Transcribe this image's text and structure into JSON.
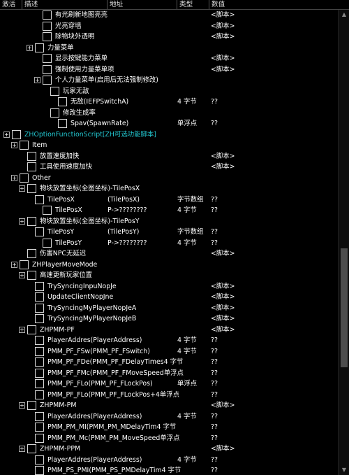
{
  "header": {
    "active": "激活",
    "description": "描述",
    "address": "地址",
    "type": "类型",
    "value": "数值"
  },
  "rows": [
    {
      "level": 4,
      "exp": false,
      "cb": true,
      "desc": "有光刷新地图亮亮",
      "addr": "",
      "type": "",
      "val": "<脚本>",
      "cyan": false
    },
    {
      "level": 4,
      "exp": false,
      "cb": true,
      "desc": "光亮穿墙",
      "addr": "",
      "type": "",
      "val": "<脚本>",
      "cyan": false
    },
    {
      "level": 4,
      "exp": false,
      "cb": true,
      "desc": "除物块外透明",
      "addr": "",
      "type": "",
      "val": "<脚本>",
      "cyan": false
    },
    {
      "level": 3,
      "exp": true,
      "cb": true,
      "desc": "力量菜单",
      "addr": "",
      "type": "",
      "val": "",
      "cyan": false
    },
    {
      "level": 4,
      "exp": false,
      "cb": true,
      "desc": "显示按键能力菜单",
      "addr": "",
      "type": "",
      "val": "<脚本>",
      "cyan": false
    },
    {
      "level": 4,
      "exp": false,
      "cb": true,
      "desc": "强制使用力量菜单项",
      "addr": "",
      "type": "",
      "val": "<脚本>",
      "cyan": false
    },
    {
      "level": 4,
      "exp": true,
      "cb": true,
      "desc": "个人力量菜单(启用后无法强制修改)",
      "addr": "",
      "type": "",
      "val": "",
      "cyan": false
    },
    {
      "level": 5,
      "exp": false,
      "cb": true,
      "desc": "玩家无敌",
      "addr": "",
      "type": "",
      "val": "",
      "cyan": false
    },
    {
      "level": 6,
      "exp": false,
      "cb": true,
      "desc": "无敌(IEFPSwitchA)",
      "addr": "",
      "type": "4 字节",
      "val": "??",
      "cyan": false
    },
    {
      "level": 5,
      "exp": false,
      "cb": true,
      "desc": "修改生成率",
      "addr": "",
      "type": "",
      "val": "",
      "cyan": false
    },
    {
      "level": 6,
      "exp": false,
      "cb": true,
      "desc": "Spav(SpawnRate)",
      "addr": "",
      "type": "单浮点",
      "val": "??",
      "cyan": false
    },
    {
      "level": 0,
      "exp": true,
      "cb": true,
      "desc": "ZHOptionFunctionScript[ZH可选功能脚本]",
      "addr": "",
      "type": "",
      "val": "",
      "cyan": true
    },
    {
      "level": 1,
      "exp": true,
      "cb": true,
      "desc": "Item",
      "addr": "",
      "type": "",
      "val": "",
      "cyan": false
    },
    {
      "level": 2,
      "exp": false,
      "cb": true,
      "desc": "放置速度加快",
      "addr": "",
      "type": "",
      "val": "<脚本>",
      "cyan": false
    },
    {
      "level": 2,
      "exp": false,
      "cb": true,
      "desc": "工具使用速度加快",
      "addr": "",
      "type": "",
      "val": "<脚本>",
      "cyan": false
    },
    {
      "level": 1,
      "exp": true,
      "cb": true,
      "desc": "Other",
      "addr": "",
      "type": "",
      "val": "",
      "cyan": false
    },
    {
      "level": 2,
      "exp": true,
      "cb": true,
      "desc": "物块放置坐标(全图坐标)-TilePosX",
      "addr": "",
      "type": "",
      "val": "",
      "cyan": false
    },
    {
      "level": 3,
      "exp": false,
      "cb": true,
      "desc": "TilePosX",
      "addr": "(TilePosX)",
      "type": "字节数组",
      "val": "??",
      "cyan": false
    },
    {
      "level": 4,
      "exp": false,
      "cb": true,
      "desc": "TilePosX",
      "addr": "P->????????",
      "type": "4 字节",
      "val": "??",
      "cyan": false
    },
    {
      "level": 2,
      "exp": true,
      "cb": true,
      "desc": "物块放置坐标(全图坐标)-TilePosY",
      "addr": "",
      "type": "",
      "val": "",
      "cyan": false
    },
    {
      "level": 3,
      "exp": false,
      "cb": true,
      "desc": "TilePosY",
      "addr": "(TilePosY)",
      "type": "字节数组",
      "val": "??",
      "cyan": false
    },
    {
      "level": 4,
      "exp": false,
      "cb": true,
      "desc": "TilePosY",
      "addr": "P->????????",
      "type": "4 字节",
      "val": "??",
      "cyan": false
    },
    {
      "level": 2,
      "exp": false,
      "cb": true,
      "desc": "伤害NPC无延迟",
      "addr": "",
      "type": "",
      "val": "<脚本>",
      "cyan": false
    },
    {
      "level": 1,
      "exp": true,
      "cb": true,
      "desc": "ZHPlayerMoveMode",
      "addr": "",
      "type": "",
      "val": "",
      "cyan": false
    },
    {
      "level": 2,
      "exp": true,
      "cb": true,
      "desc": "高速更新玩家位置",
      "addr": "",
      "type": "",
      "val": "",
      "cyan": false
    },
    {
      "level": 3,
      "exp": false,
      "cb": true,
      "desc": "TrySyncingInpuNopJe",
      "addr": "",
      "type": "",
      "val": "<脚本>",
      "cyan": false
    },
    {
      "level": 3,
      "exp": false,
      "cb": true,
      "desc": "UpdateClientNopJne",
      "addr": "",
      "type": "",
      "val": "<脚本>",
      "cyan": false
    },
    {
      "level": 3,
      "exp": false,
      "cb": true,
      "desc": "TrySyncingMyPlayerNopJeA",
      "addr": "",
      "type": "",
      "val": "<脚本>",
      "cyan": false
    },
    {
      "level": 3,
      "exp": false,
      "cb": true,
      "desc": "TrySyncingMyPlayerNopJeB",
      "addr": "",
      "type": "",
      "val": "<脚本>",
      "cyan": false
    },
    {
      "level": 2,
      "exp": true,
      "cb": true,
      "desc": "ZHPMM-PF",
      "addr": "",
      "type": "",
      "val": "<脚本>",
      "cyan": false
    },
    {
      "level": 3,
      "exp": false,
      "cb": true,
      "desc": "PlayerAddres(PlayerAddress)",
      "addr": "",
      "type": "4 字节",
      "val": "??",
      "cyan": false
    },
    {
      "level": 3,
      "exp": false,
      "cb": true,
      "desc": "PMM_PF_FSw(PMM_PF_FSwitch)",
      "addr": "",
      "type": "4 字节",
      "val": "??",
      "cyan": false
    },
    {
      "level": 3,
      "exp": false,
      "cb": true,
      "desc": "PMM_PF_FDe(PMM_PF_FDelayTimes4 字节",
      "addr": "",
      "type": "",
      "val": "??",
      "cyan": false
    },
    {
      "level": 3,
      "exp": false,
      "cb": true,
      "desc": "PMM_PF_FMc(PMM_PF_FMoveSpeed单浮点",
      "addr": "",
      "type": "",
      "val": "??",
      "cyan": false
    },
    {
      "level": 3,
      "exp": false,
      "cb": true,
      "desc": "PMM_PF_FLo(PMM_PF_FLockPos)",
      "addr": "",
      "type": "单浮点",
      "val": "??",
      "cyan": false
    },
    {
      "level": 3,
      "exp": false,
      "cb": true,
      "desc": "PMM_PF_FLo(PMM_PF_FLockPos+4单浮点",
      "addr": "",
      "type": "",
      "val": "??",
      "cyan": false
    },
    {
      "level": 2,
      "exp": true,
      "cb": true,
      "desc": "ZHPMM-PM",
      "addr": "",
      "type": "",
      "val": "<脚本>",
      "cyan": false
    },
    {
      "level": 3,
      "exp": false,
      "cb": true,
      "desc": "PlayerAddres(PlayerAddress)",
      "addr": "",
      "type": "4 字节",
      "val": "??",
      "cyan": false
    },
    {
      "level": 3,
      "exp": false,
      "cb": true,
      "desc": "PMM_PM_MI(PMM_PM_MDelayTim4 字节",
      "addr": "",
      "type": "",
      "val": "??",
      "cyan": false
    },
    {
      "level": 3,
      "exp": false,
      "cb": true,
      "desc": "PMM_PM_Mc(PMM_PM_MoveSpeed单浮点",
      "addr": "",
      "type": "",
      "val": "??",
      "cyan": false
    },
    {
      "level": 2,
      "exp": true,
      "cb": true,
      "desc": "ZHPMM-PPM",
      "addr": "",
      "type": "",
      "val": "<脚本>",
      "cyan": false
    },
    {
      "level": 3,
      "exp": false,
      "cb": true,
      "desc": "PlayerAddres(PlayerAddress)",
      "addr": "",
      "type": "4 字节",
      "val": "??",
      "cyan": false
    },
    {
      "level": 3,
      "exp": false,
      "cb": true,
      "desc": "PMM_PS_PMI(PMM_PS_PMDelayTim4 字节",
      "addr": "",
      "type": "",
      "val": "??",
      "cyan": false
    }
  ]
}
